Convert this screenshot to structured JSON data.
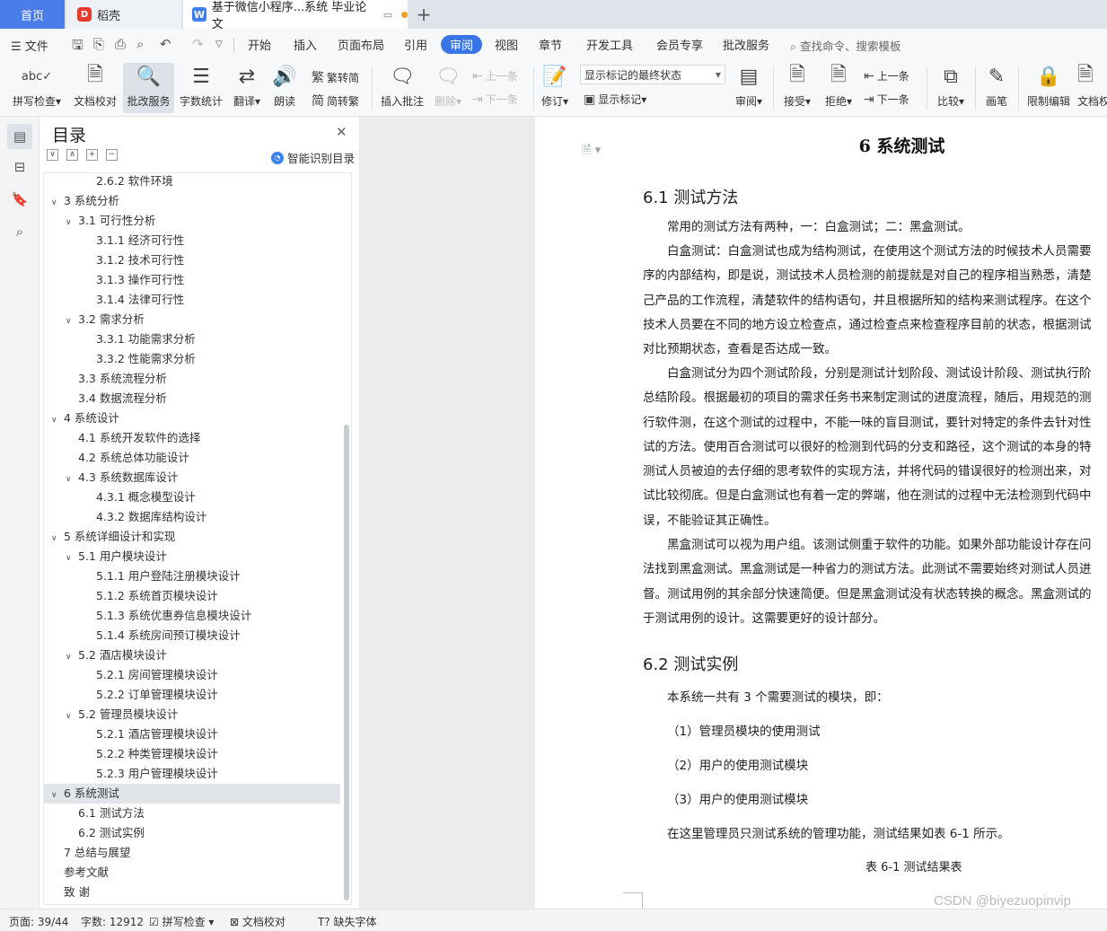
{
  "tabs": {
    "home": "首页",
    "daoke": "稻壳",
    "doc": "基于微信小程序...系统 毕业论文",
    "add": "+"
  },
  "menu": {
    "file": "文件",
    "tabs": [
      "开始",
      "插入",
      "页面布局",
      "引用",
      "审阅",
      "视图",
      "章节",
      "开发工具",
      "会员专享",
      "批改服务"
    ],
    "active": "审阅",
    "search": "查找命令、搜索模板"
  },
  "ribbon": {
    "spell": "拼写检查",
    "proof": "文档校对",
    "correct_service": "批改服务",
    "word_count": "字数统计",
    "translate": "翻译",
    "read_aloud": "朗读",
    "trad_to_simp": "繁转简",
    "simp_to_trad": "简转繁",
    "insert_comment": "插入批注",
    "delete": "删除",
    "prev": "上一条",
    "next": "下一条",
    "revise": "修订",
    "state_select": "显示标记的最终状态",
    "show_markup": "显示标记",
    "review": "审阅",
    "accept": "接受",
    "reject": "拒绝",
    "prev2": "上一条",
    "next2": "下一条",
    "compare": "比较",
    "pen": "画笔",
    "restrict": "限制编辑",
    "doc_perm": "文档权"
  },
  "toc": {
    "title": "目录",
    "smart": "智能识别目录",
    "items": [
      {
        "text": "2.6.2 软件环境",
        "level": 3
      },
      {
        "text": "3 系统分析",
        "level": 1,
        "chev": "v"
      },
      {
        "text": "3.1 可行性分析",
        "level": 2,
        "chev": "v"
      },
      {
        "text": "3.1.1 经济可行性",
        "level": 3
      },
      {
        "text": "3.1.2 技术可行性",
        "level": 3
      },
      {
        "text": "3.1.3 操作可行性",
        "level": 3
      },
      {
        "text": "3.1.4 法律可行性",
        "level": 3
      },
      {
        "text": "3.2 需求分析",
        "level": 2,
        "chev": "v"
      },
      {
        "text": "3.3.1 功能需求分析",
        "level": 3
      },
      {
        "text": "3.3.2 性能需求分析",
        "level": 3
      },
      {
        "text": "3.3 系统流程分析",
        "level": 2
      },
      {
        "text": "3.4 数据流程分析",
        "level": 2
      },
      {
        "text": "4 系统设计",
        "level": 1,
        "chev": "v"
      },
      {
        "text": "4.1 系统开发软件的选择",
        "level": 2
      },
      {
        "text": "4.2 系统总体功能设计",
        "level": 2
      },
      {
        "text": "4.3 系统数据库设计",
        "level": 2,
        "chev": "v"
      },
      {
        "text": "4.3.1 概念模型设计",
        "level": 3
      },
      {
        "text": "4.3.2 数据库结构设计",
        "level": 3
      },
      {
        "text": "5 系统详细设计和实现",
        "level": 1,
        "chev": "v"
      },
      {
        "text": "5.1 用户模块设计",
        "level": 2,
        "chev": "v"
      },
      {
        "text": "5.1.1 用户登陆注册模块设计",
        "level": 3
      },
      {
        "text": "5.1.2 系统首页模块设计",
        "level": 3
      },
      {
        "text": "5.1.3 系统优惠券信息模块设计",
        "level": 3
      },
      {
        "text": "5.1.4 系统房间预订模块设计",
        "level": 3
      },
      {
        "text": "5.2 酒店模块设计",
        "level": 2,
        "chev": "v"
      },
      {
        "text": "5.2.1 房间管理模块设计",
        "level": 3
      },
      {
        "text": "5.2.2 订单管理模块设计",
        "level": 3
      },
      {
        "text": "5.2 管理员模块设计",
        "level": 2,
        "chev": "v"
      },
      {
        "text": "5.2.1 酒店管理模块设计",
        "level": 3
      },
      {
        "text": "5.2.2 种类管理模块设计",
        "level": 3
      },
      {
        "text": "5.2.3 用户管理模块设计",
        "level": 3
      },
      {
        "text": "6 系统测试",
        "level": 1,
        "chev": "v",
        "selected": true
      },
      {
        "text": "6.1 测试方法",
        "level": 2
      },
      {
        "text": "6.2 测试实例",
        "level": 2
      },
      {
        "text": "7  总结与展望",
        "level": 1
      },
      {
        "text": "参考文献",
        "level": 1
      },
      {
        "text": "致  谢",
        "level": 1
      }
    ]
  },
  "doc": {
    "h1": "6 系统测试",
    "h2_1": "6.1 测试方法",
    "p1": [
      "常用的测试方法有两种，一：白盒测试；二：黑盒测试。"
    ],
    "p2": [
      "白盒测试：白盒测试也成为结构测试，在使用这个测试方法的时候技术人员需要",
      "序的内部结构，即是说，测试技术人员检测的前提就是对自己的程序相当熟悉，清楚",
      "己产品的工作流程，清楚软件的结构语句，并且根据所知的结构来测试程序。在这个",
      "技术人员要在不同的地方设立检查点，通过检查点来检查程序目前的状态，根据测试",
      "对比预期状态，查看是否达成一致。"
    ],
    "p3": [
      "白盒测试分为四个测试阶段，分别是测试计划阶段、测试设计阶段、测试执行阶",
      "总结阶段。根据最初的项目的需求任务书来制定测试的进度流程，随后，用规范的测",
      "行软件测，在这个测试的过程中，不能一味的盲目测试，要针对特定的条件去针对性",
      "试的方法。使用百合测试可以很好的检测到代码的分支和路径，这个测试的本身的特",
      "测试人员被迫的去仔细的思考软件的实现方法，并将代码的错误很好的检测出来，对",
      "试比较彻底。但是白盒测试也有着一定的弊端，他在测试的过程中无法检测到代码中",
      "误，不能验证其正确性。"
    ],
    "p4": [
      "黑盒测试可以视为用户组。该测试侧重于软件的功能。如果外部功能设计存在问",
      "法找到黑盒测试。黑盒测试是一种省力的测试方法。此测试不需要始终对测试人员进",
      "督。测试用例的其余部分快速简便。但是黑盒测试没有状态转换的概念。黑盒测试的",
      "于测试用例的设计。这需要更好的设计部分。"
    ],
    "h2_2": "6.2 测试实例",
    "l1": "本系统一共有 3 个需要测试的模块，即：",
    "l2": "（1）管理员模块的使用测试",
    "l3": "（2）用户的使用测试模块",
    "l4": "（3）用户的使用测试模块",
    "l5": "在这里管理员只测试系统的管理功能，测试结果如表 6-1 所示。",
    "caption": "表 6-1 测试结果表"
  },
  "status": {
    "page": "页面: 39/44",
    "words": "字数: 12912",
    "spell": "拼写检查",
    "proof": "文档校对",
    "missing_font": "缺失字体"
  },
  "watermark": "CSDN @biyezuopinvip",
  "colors": {
    "accent": "#3b74e6",
    "home_tab": "#4a7de8",
    "selection": "#e1e4e9"
  }
}
